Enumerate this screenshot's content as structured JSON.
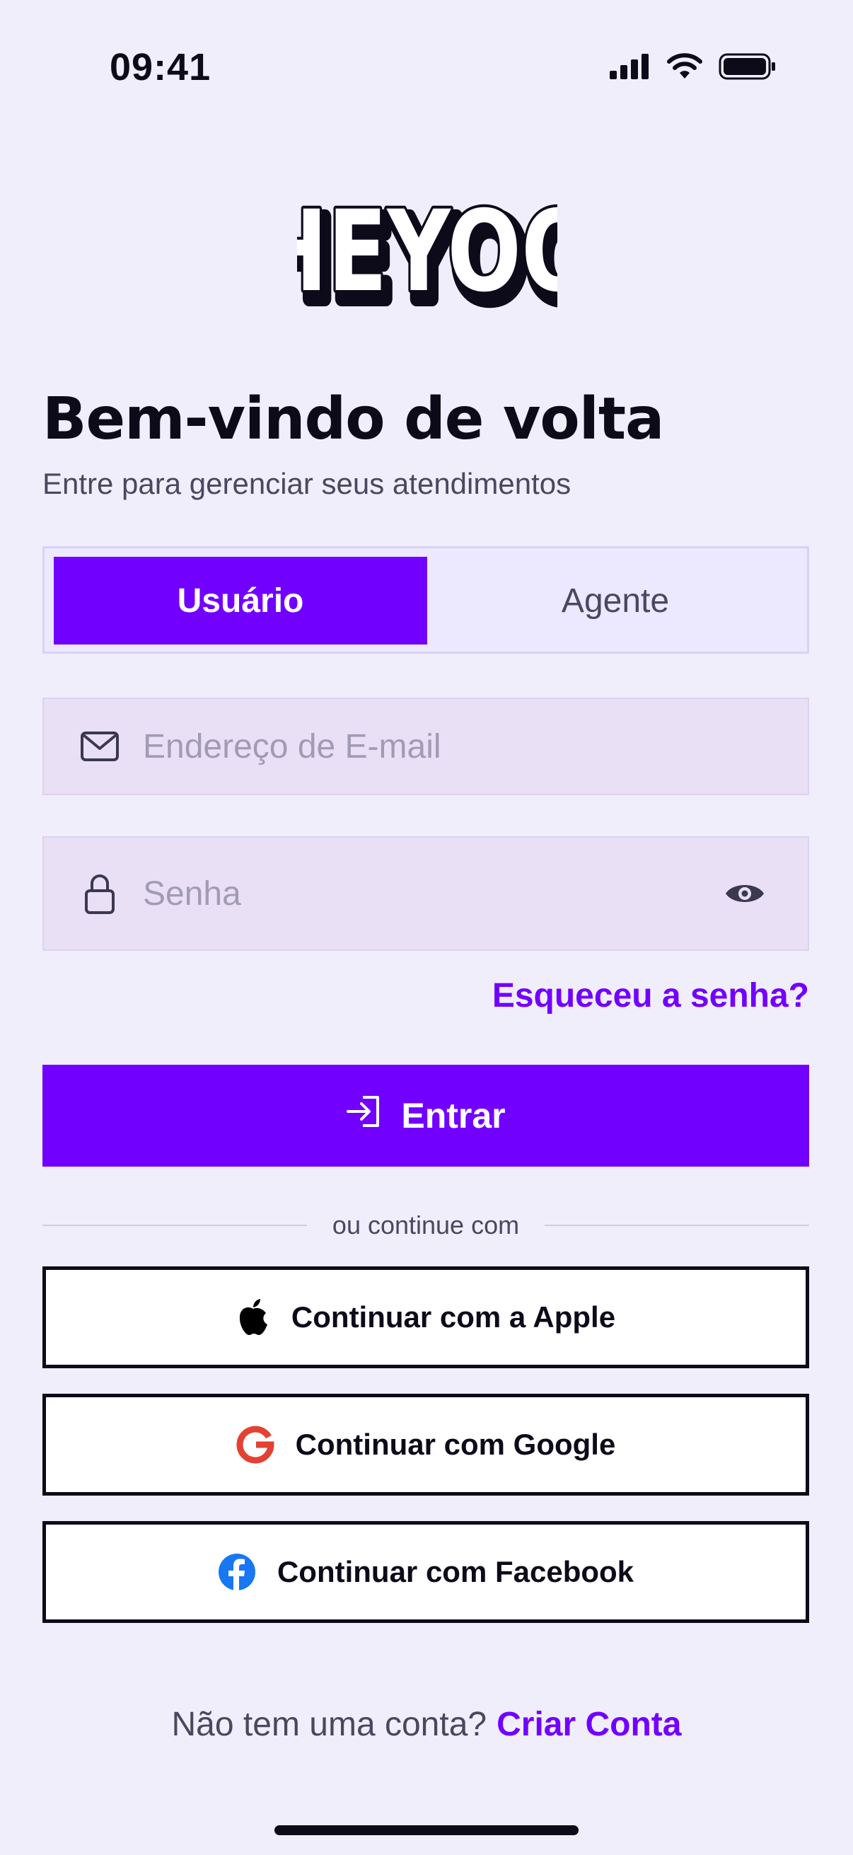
{
  "status_bar": {
    "time": "09:41"
  },
  "brand": {
    "logo_text": "HEYOO",
    "accent": "#7200ff"
  },
  "header": {
    "title": "Bem-vindo de volta",
    "subtitle": "Entre para gerenciar seus atendimentos"
  },
  "segment": {
    "user_label": "Usuário",
    "agent_label": "Agente",
    "selected": "Usuário"
  },
  "form": {
    "email_placeholder": "Endereço de E-mail",
    "email_value": "",
    "password_placeholder": "Senha",
    "password_value": "",
    "forgot_label": "Esqueceu a senha?",
    "submit_label": "Entrar"
  },
  "divider_label": "ou continue com",
  "social": {
    "apple_label": "Continuar com a Apple",
    "google_label": "Continuar com Google",
    "facebook_label": "Continuar com Facebook"
  },
  "signup": {
    "prompt": "Não tem uma conta?",
    "link": "Criar Conta"
  },
  "icons": {
    "status": [
      "signal-icon",
      "wifi-icon",
      "battery-icon"
    ],
    "email": "mail-icon",
    "password": "lock-icon",
    "toggle": "eye-icon",
    "submit": "login-icon"
  }
}
